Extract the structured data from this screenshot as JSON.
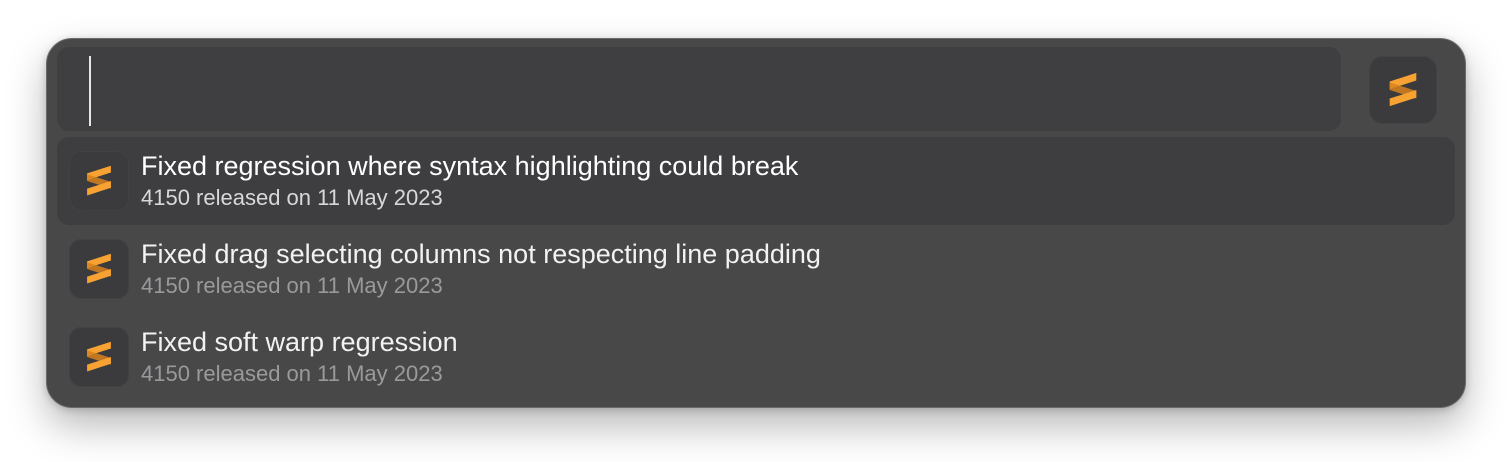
{
  "search": {
    "value": "",
    "placeholder": ""
  },
  "app_icon": {
    "name": "sublime-text-icon",
    "color": "#f7a233"
  },
  "results": [
    {
      "title": "Fixed regression where syntax highlighting could break",
      "subtitle": "4150 released on 11 May 2023",
      "selected": true
    },
    {
      "title": "Fixed drag selecting columns not respecting line padding",
      "subtitle": "4150 released on 11 May 2023",
      "selected": false
    },
    {
      "title": "Fixed soft warp regression",
      "subtitle": "4150 released on 11 May 2023",
      "selected": false
    }
  ],
  "colors": {
    "panel": "#484849",
    "selected_row": "#3e3e40",
    "accent": "#f7a233"
  }
}
